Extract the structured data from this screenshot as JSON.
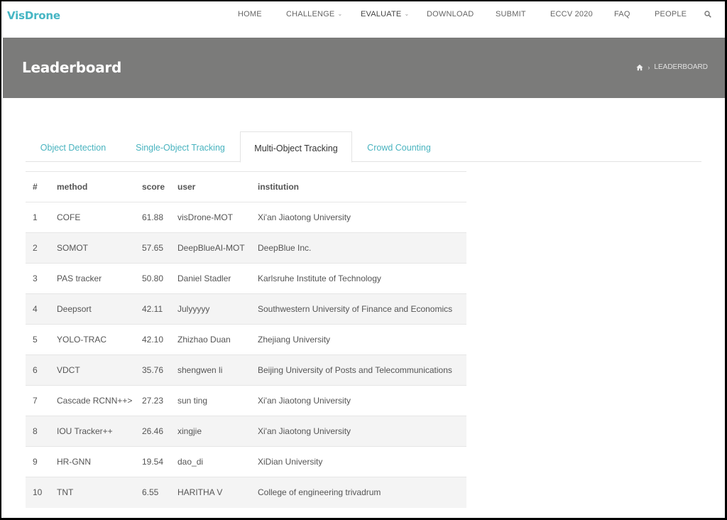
{
  "logo": "VisDrone",
  "nav": {
    "items": [
      {
        "label": "HOME",
        "dropdown": false
      },
      {
        "label": "CHALLENGE",
        "dropdown": true
      },
      {
        "label": "EVALUATE",
        "dropdown": true
      },
      {
        "label": "DOWNLOAD",
        "dropdown": false
      },
      {
        "label": "SUBMIT",
        "dropdown": false
      },
      {
        "label": "ECCV 2020",
        "dropdown": false
      },
      {
        "label": "FAQ",
        "dropdown": false
      },
      {
        "label": "PEOPLE",
        "dropdown": false
      }
    ],
    "active": "EVALUATE"
  },
  "banner": {
    "title": "Leaderboard",
    "breadcrumb_current": "LEADERBOARD"
  },
  "tabs": [
    {
      "label": "Object Detection",
      "active": false
    },
    {
      "label": "Single-Object Tracking",
      "active": false
    },
    {
      "label": "Multi-Object Tracking",
      "active": true
    },
    {
      "label": "Crowd Counting",
      "active": false
    }
  ],
  "table": {
    "headers": [
      "#",
      "method",
      "score",
      "user",
      "institution"
    ],
    "rows": [
      [
        "1",
        "COFE",
        "61.88",
        "visDrone-MOT",
        "Xi'an Jiaotong University"
      ],
      [
        "2",
        "SOMOT",
        "57.65",
        "DeepBlueAI-MOT",
        "DeepBlue Inc."
      ],
      [
        "3",
        "PAS tracker",
        "50.80",
        "Daniel Stadler",
        "Karlsruhe Institute of Technology"
      ],
      [
        "4",
        "Deepsort",
        "42.11",
        "Julyyyyy",
        "Southwestern University of Finance and Economics"
      ],
      [
        "5",
        "YOLO-TRAC",
        "42.10",
        "Zhizhao Duan",
        "Zhejiang University"
      ],
      [
        "6",
        "VDCT",
        "35.76",
        "shengwen li",
        "Beijing University of Posts and Telecommunications"
      ],
      [
        "7",
        "Cascade RCNN++>",
        "27.23",
        "sun ting",
        "Xi'an Jiaotong University"
      ],
      [
        "8",
        "IOU Tracker++",
        "26.46",
        "xingjie",
        "Xi'an Jiaotong University"
      ],
      [
        "9",
        "HR-GNN",
        "19.54",
        "dao_di",
        "XiDian University"
      ],
      [
        "10",
        "TNT",
        "6.55",
        "HARITHA V",
        "College of engineering trivadrum"
      ]
    ]
  },
  "colors": {
    "brand": "#46b6c4",
    "banner": "#7b7b7a",
    "tab_link": "#48b3bf"
  }
}
